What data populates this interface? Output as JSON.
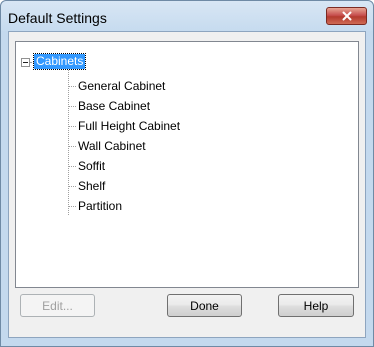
{
  "window": {
    "title": "Default Settings"
  },
  "tree": {
    "root": {
      "label": "Cabinets",
      "expanded": true,
      "selected": true
    },
    "children": [
      "General Cabinet",
      "Base Cabinet",
      "Full Height Cabinet",
      "Wall Cabinet",
      "Soffit",
      "Shelf",
      "Partition"
    ]
  },
  "buttons": {
    "edit": "Edit...",
    "done": "Done",
    "help": "Help"
  },
  "colors": {
    "selection": "#3399ff",
    "close_button": "#c75050",
    "frame": "#c4d9ee"
  }
}
